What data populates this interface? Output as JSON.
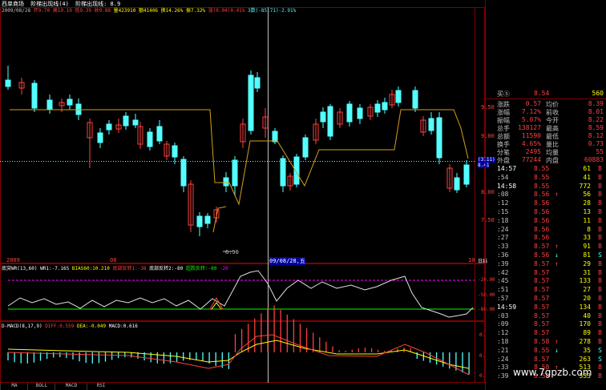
{
  "title": "西单商场",
  "indicator_name": "阶梯出现线(4)",
  "indicator_value": "阶梯出现线: 8.9",
  "ohlc_bar": {
    "date": "2009/08/28",
    "open": "开9.70",
    "high": "高10.10",
    "low": "低9.39",
    "close": "收9.88",
    "volume": "量423910",
    "amount": "额41406",
    "turnover": "换14.26%",
    "amplitude": "振7.32%",
    "change": "涨(0.04)0.41%",
    "extra": "3数(-85.71)-2.91%"
  },
  "price_axis": [
    "9.50",
    "9.00",
    "8.50",
    "8.00",
    "7.50"
  ],
  "crosshair_price": "8.41",
  "crosshair_price_tag": "(3111)",
  "min_price_label": "6.90",
  "date_axis": {
    "left": "2009",
    "mid": "08",
    "cursor": "09/08/28,五",
    "right_tick": "10",
    "period": "日线"
  },
  "wr_panel": {
    "label": "底突WR(13,60)",
    "wr1": "WR1:-7.165",
    "bias": "BIAS60:10.210",
    "s1": "底部反转1:-38",
    "s2": "底部反转2:-80",
    "s3": "超跌反转:-80",
    "s4": "-20",
    "axis": [
      "-20.00",
      "-50.00",
      "-80.00"
    ]
  },
  "macd_panel": {
    "label": "D-MACD(8,17,9)",
    "diff": "DIFF:0.559",
    "dea": "DEA:-0.049",
    "macd": "MACD:0.616",
    "axis": [
      "0.",
      "0.",
      "0."
    ]
  },
  "tabs": [
    "MA",
    "BOLL",
    "MACD",
    "RSI"
  ],
  "watermark": "www.7gpzb.com",
  "quote": {
    "buy_label": "买⑤",
    "buy_price": "8.54",
    "buy_vol": "560",
    "rows": [
      {
        "l1": "涨跌",
        "v1": "0.57",
        "l2": "均价",
        "v2": "8.39"
      },
      {
        "l1": "涨幅",
        "v1": "7.12%",
        "l2": "前收",
        "v2": "8.01"
      },
      {
        "l1": "振幅",
        "v1": "5.07%",
        "l2": "今开",
        "v2": "8.22"
      },
      {
        "l1": "总手",
        "v1": "138127",
        "l2": "最高",
        "v2": "8.59"
      },
      {
        "l1": "总额",
        "v1": "11590",
        "l2": "最低",
        "v2": "8.12"
      },
      {
        "l1": "换手",
        "v1": "4.65%",
        "l2": "量比",
        "v2": "0.73"
      },
      {
        "l1": "分笔",
        "v1": "2495",
        "l2": "均量",
        "v2": "55"
      },
      {
        "l1": "外盘",
        "v1": "77244",
        "l2": "内盘",
        "v2": "60883"
      }
    ]
  },
  "ticks": [
    {
      "t": "14:57",
      "p": "8.55",
      "a": "",
      "v": "61",
      "s": "B"
    },
    {
      "t": ":54",
      "p": "8.55",
      "a": "",
      "v": "41",
      "s": "B"
    },
    {
      "t": "14:58",
      "p": "8.55",
      "a": "",
      "v": "772",
      "s": "B"
    },
    {
      "t": ":08",
      "p": "8.56",
      "a": "↑",
      "v": "56",
      "s": "B"
    },
    {
      "t": ":12",
      "p": "8.56",
      "a": "",
      "v": "28",
      "s": "B"
    },
    {
      "t": ":15",
      "p": "8.56",
      "a": "",
      "v": "13",
      "s": "B"
    },
    {
      "t": ":18",
      "p": "8.56",
      "a": "",
      "v": "11",
      "s": "B"
    },
    {
      "t": ":24",
      "p": "8.56",
      "a": "",
      "v": "8",
      "s": "B"
    },
    {
      "t": ":27",
      "p": "8.56",
      "a": "",
      "v": "33",
      "s": "B"
    },
    {
      "t": ":33",
      "p": "8.57",
      "a": "↑",
      "v": "91",
      "s": "B"
    },
    {
      "t": ":36",
      "p": "8.56",
      "a": "↓",
      "v": "81",
      "s": "S"
    },
    {
      "t": ":39",
      "p": "8.57",
      "a": "↑",
      "v": "29",
      "s": "B"
    },
    {
      "t": ":42",
      "p": "8.57",
      "a": "",
      "v": "31",
      "s": "B"
    },
    {
      "t": ":45",
      "p": "8.57",
      "a": "",
      "v": "133",
      "s": "B"
    },
    {
      "t": ":51",
      "p": "8.57",
      "a": "",
      "v": "27",
      "s": "B"
    },
    {
      "t": ":57",
      "p": "8.57",
      "a": "",
      "v": "20",
      "s": "B"
    },
    {
      "t": "14:59",
      "p": "8.57",
      "a": "",
      "v": "134",
      "s": "B"
    },
    {
      "t": ":03",
      "p": "8.57",
      "a": "",
      "v": "40",
      "s": "B"
    },
    {
      "t": ":09",
      "p": "8.57",
      "a": "",
      "v": "170",
      "s": "B"
    },
    {
      "t": ":12",
      "p": "8.57",
      "a": "",
      "v": "89",
      "s": "B"
    },
    {
      "t": ":18",
      "p": "8.58",
      "a": "↑",
      "v": "278",
      "s": "B"
    },
    {
      "t": ":21",
      "p": "8.55",
      "a": "↓",
      "v": "35",
      "s": "S"
    },
    {
      "t": ":24",
      "p": "8.57",
      "a": "",
      "v": "263",
      "s": "S"
    },
    {
      "t": ":33",
      "p": "8.58",
      "a": "↑",
      "v": "513",
      "b": "",
      "s": "B"
    },
    {
      "t": ":39",
      "p": "8.58",
      "a": "",
      "v": "333",
      "s": "B"
    }
  ],
  "colors": {
    "up": "#ff4040",
    "down": "#54ffff",
    "bg": "#000000",
    "border": "#800000",
    "ladder": "#d4a017"
  }
}
